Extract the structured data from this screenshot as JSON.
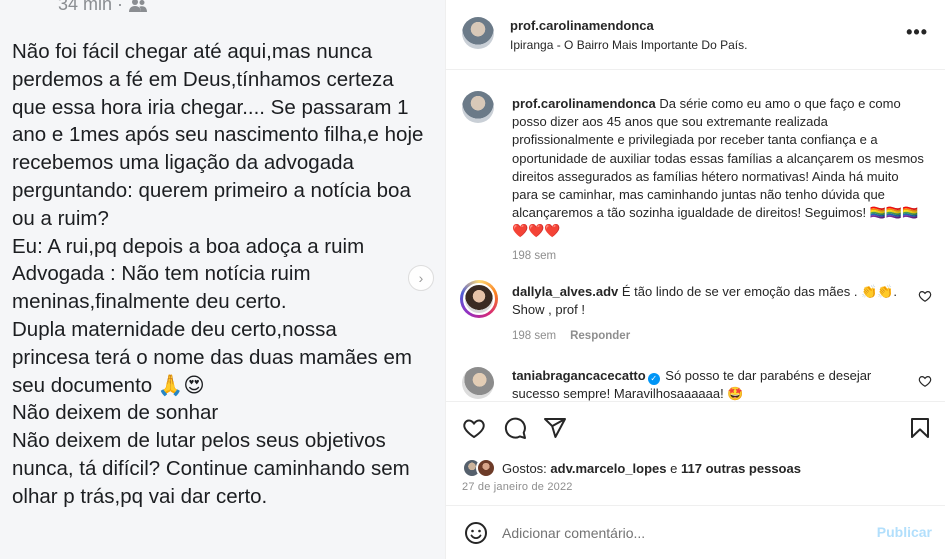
{
  "post_image": {
    "time": "34 min ·",
    "lines": [
      "Não foi fácil chegar até aqui,mas nunca",
      "perdemos a fé em Deus,tínhamos certeza",
      "que essa hora iria chegar.... Se passaram 1",
      "ano e 1mes após seu nascimento filha,e hoje",
      "recebemos uma ligação da advogada",
      "perguntando: querem primeiro a notícia boa",
      "ou a ruim?",
      "Eu: A rui,pq depois a boa adoça a ruim",
      "Advogada : Não tem notícia ruim",
      "meninas,finalmente deu certo.",
      "Dupla maternidade deu certo,nossa",
      "princesa terá o nome das duas mamães em",
      "seu documento 🙏😍",
      "Não deixem de sonhar",
      "Não deixem de lutar pelos seus objetivos",
      "nunca, tá difícil? Continue caminhando sem",
      "olhar p trás,pq vai dar certo."
    ]
  },
  "header": {
    "username": "prof.carolinamendonca",
    "location": "Ipiranga - O Bairro Mais Importante Do País.",
    "more": "•••"
  },
  "caption": {
    "username": "prof.carolinamendonca",
    "text": "Da série como eu amo o que faço e como posso dizer aos 45 anos que sou extremante realizada profissionalmente e privilegiada por receber tanta confiança e a oportunidade de auxiliar todas essas famílias a alcançarem os mesmos direitos assegurados as famílias hétero normativas! Ainda há muito para se caminhar, mas caminhando juntas não tenho dúvida que alcançaremos a tão sozinha igualdade de direitos! Seguimos! 🏳️‍🌈🏳️‍🌈🏳️‍🌈❤️❤️❤️",
    "time": "198 sem"
  },
  "comments": [
    {
      "username": "dallyla_alves.adv",
      "text": "É tão lindo de se ver emoção das mães . 👏👏. Show , prof !",
      "time": "198 sem",
      "reply": "Responder"
    },
    {
      "username": "taniabragancacecatto",
      "text": "Só posso te dar parabéns e desejar sucesso sempre! Maravilhosaaaaaa! 🤩"
    }
  ],
  "likes": {
    "prefix": "Gostos:",
    "user": "adv.marcelo_lopes",
    "joiner": "e",
    "others": "117 outras pessoas"
  },
  "date": "27 de janeiro de 2022",
  "add_comment": {
    "placeholder": "Adicionar comentário...",
    "publish": "Publicar"
  },
  "colors": {
    "link_disabled": "#b2dffc",
    "verified": "#0095f6",
    "muted": "#8e8e8e"
  }
}
